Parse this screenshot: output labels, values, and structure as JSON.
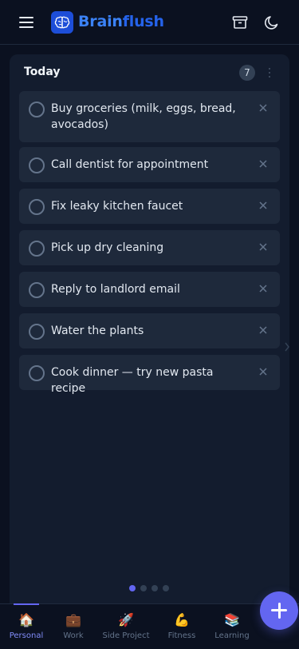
{
  "header": {
    "brand_part1": "Brain",
    "brand_part2": "flush",
    "icons": [
      "menu-icon",
      "brain-logo-icon",
      "archive-icon",
      "moon-icon"
    ]
  },
  "column": {
    "title": "Today",
    "count": "7",
    "tasks": [
      {
        "text": "Buy groceries (milk, eggs, bread, avocados)"
      },
      {
        "text": "Call dentist for appointment"
      },
      {
        "text": "Fix leaky kitchen faucet"
      },
      {
        "text": "Pick up dry cleaning"
      },
      {
        "text": "Reply to landlord email"
      },
      {
        "text": "Water the plants"
      },
      {
        "text": "Cook dinner — try new pasta recipe"
      }
    ]
  },
  "pagination": {
    "total": 4,
    "active_index": 0
  },
  "bottom_nav": {
    "items": [
      {
        "label": "Personal",
        "icon": "🏠",
        "active": true
      },
      {
        "label": "Work",
        "icon": "💼",
        "active": false
      },
      {
        "label": "Side Project",
        "icon": "🚀",
        "active": false
      },
      {
        "label": "Fitness",
        "icon": "💪",
        "active": false
      },
      {
        "label": "Learning",
        "icon": "📚",
        "active": false
      }
    ]
  },
  "colors": {
    "background": "#0b1120",
    "card": "#131c2e",
    "task": "#1e293b",
    "accent": "#6366f1",
    "brand": "#2563eb"
  }
}
